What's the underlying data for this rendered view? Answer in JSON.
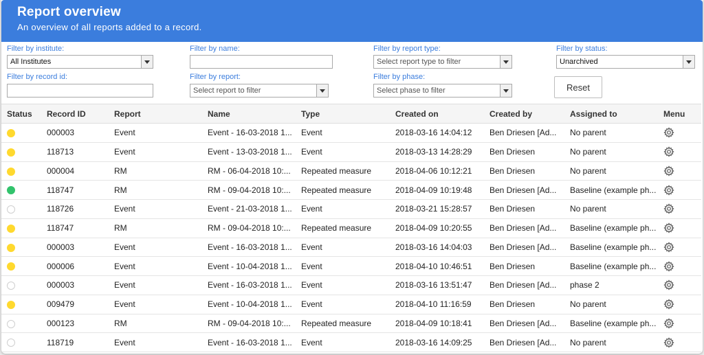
{
  "header": {
    "title": "Report overview",
    "subtitle": "An overview of all reports added to a record."
  },
  "filters": {
    "institute": {
      "label": "Filter by institute:",
      "value": "All Institutes"
    },
    "name": {
      "label": "Filter by name:",
      "value": ""
    },
    "report_type": {
      "label": "Filter by report type:",
      "placeholder": "Select report type to filter"
    },
    "status": {
      "label": "Filter by status:",
      "value": "Unarchived"
    },
    "record_id": {
      "label": "Filter by record id:",
      "value": ""
    },
    "report": {
      "label": "Filter by report:",
      "placeholder": "Select report to filter"
    },
    "phase": {
      "label": "Filter by phase:",
      "placeholder": "Select phase to filter"
    },
    "reset_label": "Reset"
  },
  "table": {
    "columns": [
      "Status",
      "Record ID",
      "Report",
      "Name",
      "Type",
      "Created on",
      "Created by",
      "Assigned to",
      "Menu"
    ],
    "status_colors": {
      "yellow": "#ffd92e",
      "green": "#32c36c",
      "empty": "#ffffff"
    },
    "rows": [
      {
        "status": "yellow",
        "record_id": "000003",
        "report": "Event",
        "name": "Event - 16-03-2018 1...",
        "type": "Event",
        "created_on": "2018-03-16 14:04:12",
        "created_by": "Ben Driesen [Ad...",
        "assigned_to": "No parent"
      },
      {
        "status": "yellow",
        "record_id": "118713",
        "report": "Event",
        "name": "Event - 13-03-2018 1...",
        "type": "Event",
        "created_on": "2018-03-13 14:28:29",
        "created_by": "Ben Driesen",
        "assigned_to": "No parent"
      },
      {
        "status": "yellow",
        "record_id": "000004",
        "report": "RM",
        "name": "RM - 06-04-2018 10:...",
        "type": "Repeated measure",
        "created_on": "2018-04-06 10:12:21",
        "created_by": "Ben Driesen",
        "assigned_to": "No parent"
      },
      {
        "status": "green",
        "record_id": "118747",
        "report": "RM",
        "name": "RM - 09-04-2018 10:...",
        "type": "Repeated measure",
        "created_on": "2018-04-09 10:19:48",
        "created_by": "Ben Driesen [Ad...",
        "assigned_to": "Baseline (example ph..."
      },
      {
        "status": "empty",
        "record_id": "118726",
        "report": "Event",
        "name": "Event - 21-03-2018 1...",
        "type": "Event",
        "created_on": "2018-03-21 15:28:57",
        "created_by": "Ben Driesen",
        "assigned_to": "No parent"
      },
      {
        "status": "yellow",
        "record_id": "118747",
        "report": "RM",
        "name": "RM - 09-04-2018 10:...",
        "type": "Repeated measure",
        "created_on": "2018-04-09 10:20:55",
        "created_by": "Ben Driesen [Ad...",
        "assigned_to": "Baseline (example ph..."
      },
      {
        "status": "yellow",
        "record_id": "000003",
        "report": "Event",
        "name": "Event - 16-03-2018 1...",
        "type": "Event",
        "created_on": "2018-03-16 14:04:03",
        "created_by": "Ben Driesen [Ad...",
        "assigned_to": "Baseline (example ph..."
      },
      {
        "status": "yellow",
        "record_id": "000006",
        "report": "Event",
        "name": "Event - 10-04-2018 1...",
        "type": "Event",
        "created_on": "2018-04-10 10:46:51",
        "created_by": "Ben Driesen",
        "assigned_to": "Baseline (example ph..."
      },
      {
        "status": "empty",
        "record_id": "000003",
        "report": "Event",
        "name": "Event - 16-03-2018 1...",
        "type": "Event",
        "created_on": "2018-03-16 13:51:47",
        "created_by": "Ben Driesen [Ad...",
        "assigned_to": "phase 2"
      },
      {
        "status": "yellow",
        "record_id": "009479",
        "report": "Event",
        "name": "Event - 10-04-2018 1...",
        "type": "Event",
        "created_on": "2018-04-10 11:16:59",
        "created_by": "Ben Driesen",
        "assigned_to": "No parent"
      },
      {
        "status": "empty",
        "record_id": "000123",
        "report": "RM",
        "name": "RM - 09-04-2018 10:...",
        "type": "Repeated measure",
        "created_on": "2018-04-09 10:18:41",
        "created_by": "Ben Driesen [Ad...",
        "assigned_to": "Baseline (example ph..."
      },
      {
        "status": "empty",
        "record_id": "118719",
        "report": "Event",
        "name": "Event - 16-03-2018 1...",
        "type": "Event",
        "created_on": "2018-03-16 14:09:25",
        "created_by": "Ben Driesen [Ad...",
        "assigned_to": "No parent"
      }
    ]
  }
}
